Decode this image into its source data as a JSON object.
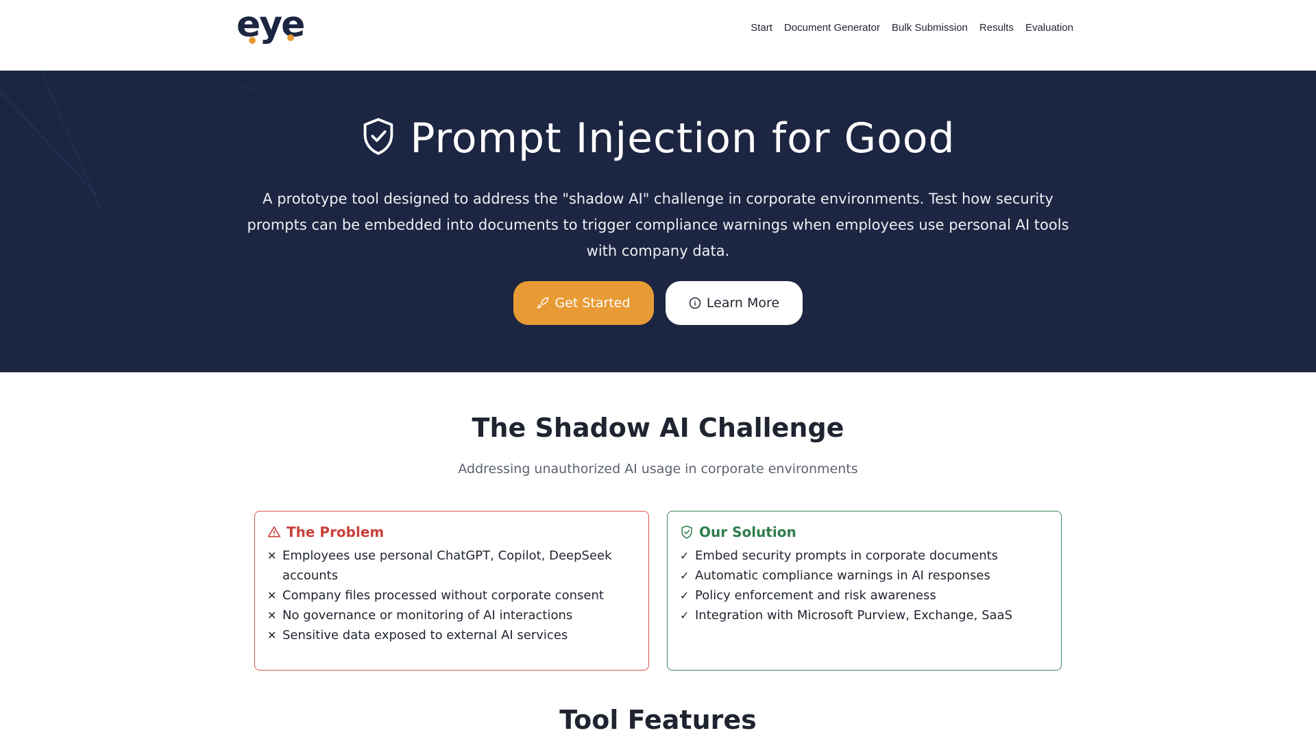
{
  "header": {
    "logo_text": "eye",
    "nav": [
      "Start",
      "Document Generator",
      "Bulk Submission",
      "Results",
      "Evaluation"
    ]
  },
  "hero": {
    "title": "Prompt Injection for Good",
    "description": "A prototype tool designed to address the \"shadow AI\" challenge in corporate environments. Test how security prompts can be embedded into documents to trigger compliance warnings when employees use personal AI tools with company data.",
    "primary_button": "Get Started",
    "secondary_button": "Learn More"
  },
  "challenge": {
    "title": "The Shadow AI Challenge",
    "subtitle": "Addressing unauthorized AI usage in corporate environments",
    "problem": {
      "title": "The Problem",
      "items": [
        "Employees use personal ChatGPT, Copilot, DeepSeek accounts",
        "Company files processed without corporate consent",
        "No governance or monitoring of AI interactions",
        "Sensitive data exposed to external AI services"
      ]
    },
    "solution": {
      "title": "Our Solution",
      "items": [
        "Embed security prompts in corporate documents",
        "Automatic compliance warnings in AI responses",
        "Policy enforcement and risk awareness",
        "Integration with Microsoft Purview, Exchange, SaaS"
      ]
    }
  },
  "features": {
    "title": "Tool Features"
  },
  "colors": {
    "hero_bg": "#1c2541",
    "accent": "#e89b35",
    "problem": "#c9403c",
    "solution": "#2f7d4b"
  }
}
